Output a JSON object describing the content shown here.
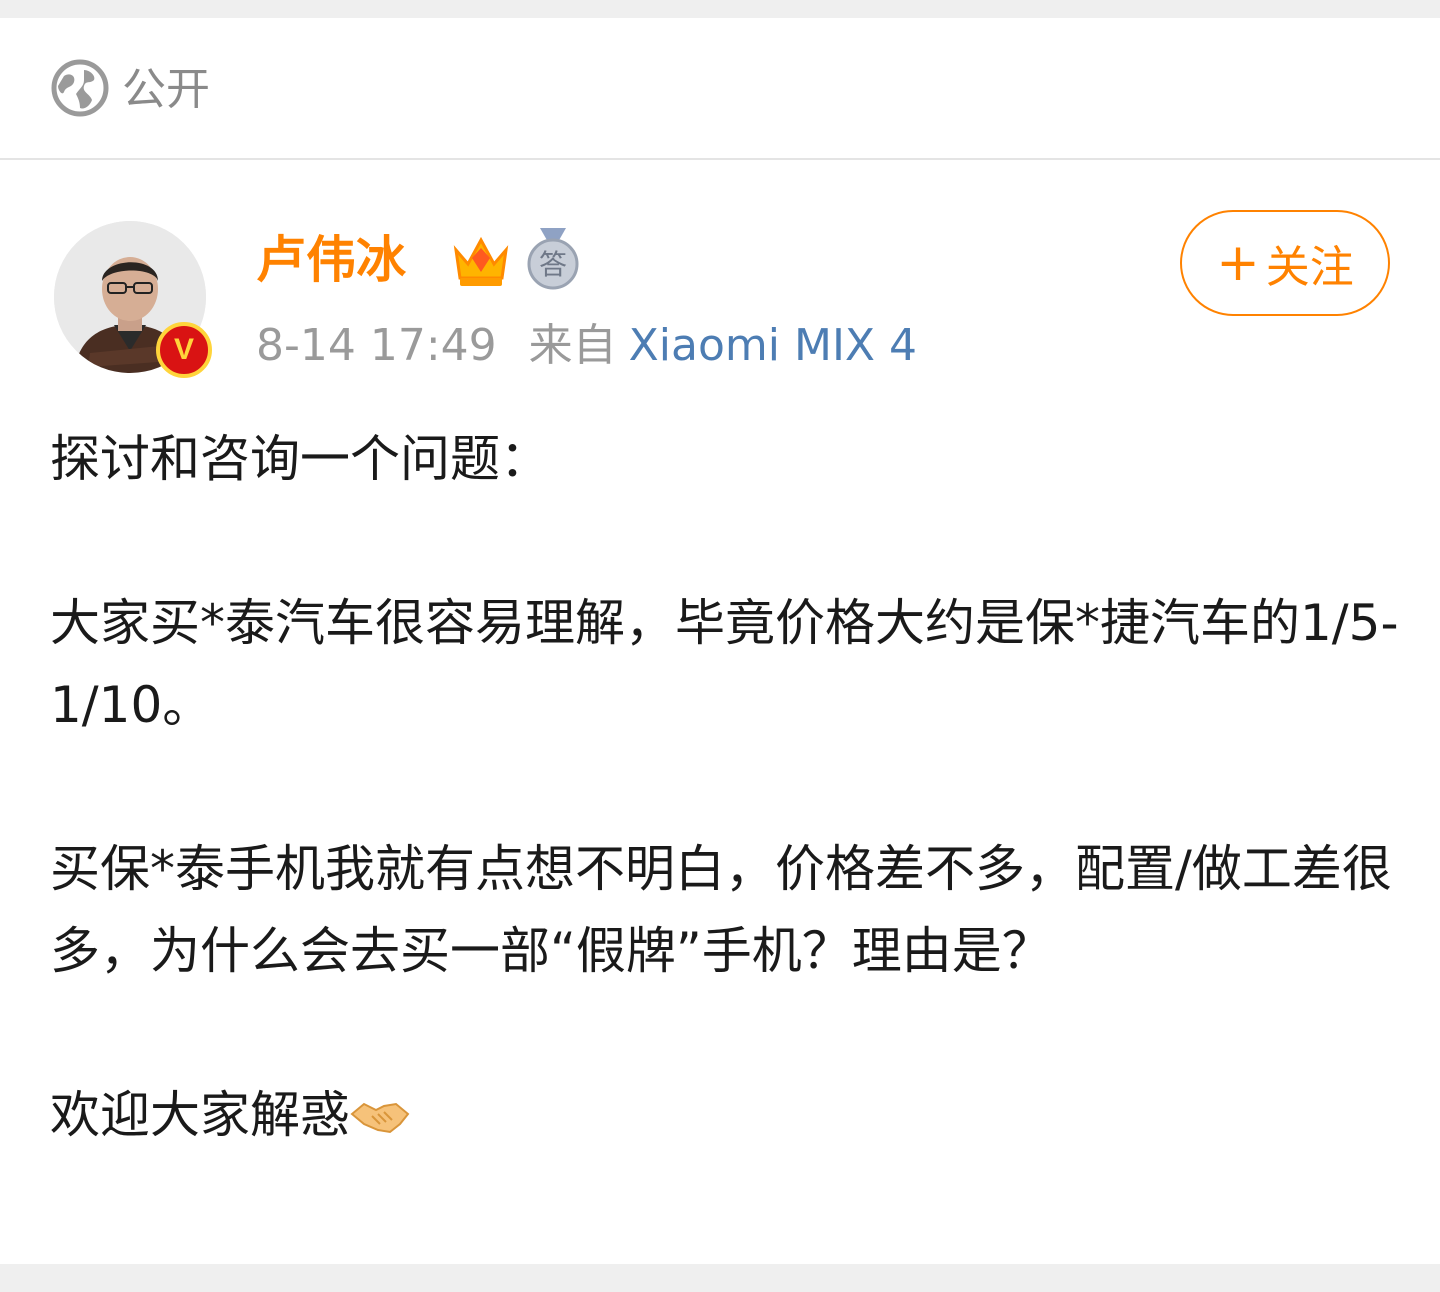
{
  "visibility": {
    "label": "公开",
    "icon": "globe-icon"
  },
  "author": {
    "name": "卢伟冰",
    "verified_badge": "V",
    "colors": {
      "name": "#ff8200",
      "badge": "#d91313"
    }
  },
  "meta": {
    "time": "8-14 17:49",
    "from_label": "来自",
    "source": "Xiaomi MIX 4"
  },
  "follow_button": {
    "plus": "+",
    "label": "关注"
  },
  "post": {
    "paragraphs": [
      "探讨和咨询一个问题：",
      "大家买*泰汽车很容易理解，毕竟价格大约是保*捷汽车的1/5-1/10。",
      "买保*泰手机我就有点想不明白，价格差不多，配置/做工差很多，为什么会去买一部“假牌”手机？理由是？",
      "欢迎大家解惑"
    ],
    "emoji": "handshake-icon"
  }
}
